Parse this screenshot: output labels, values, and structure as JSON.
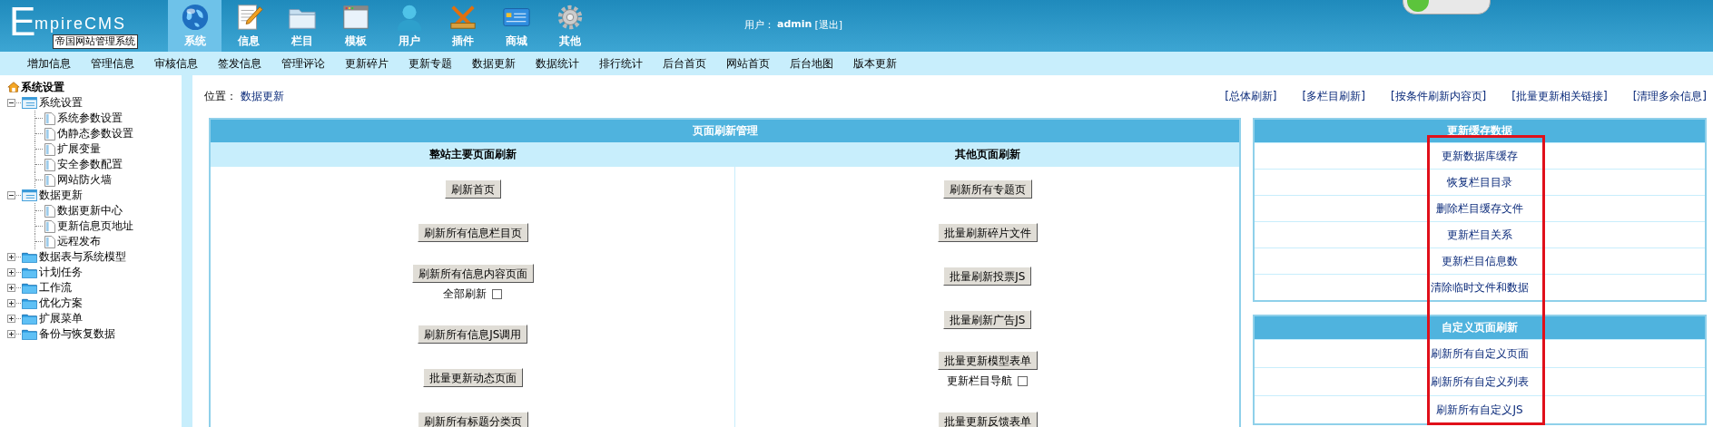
{
  "logo": {
    "big": "E",
    "rest": "mpireCMS",
    "caption": "帝国网站管理系统"
  },
  "nav": [
    {
      "label": "系统",
      "selected": true
    },
    {
      "label": "信息",
      "selected": false
    },
    {
      "label": "栏目",
      "selected": false
    },
    {
      "label": "模板",
      "selected": false
    },
    {
      "label": "用户",
      "selected": false
    },
    {
      "label": "插件",
      "selected": false
    },
    {
      "label": "商城",
      "selected": false
    },
    {
      "label": "其他",
      "selected": false
    }
  ],
  "user": {
    "label": "用户：",
    "name": "admin",
    "logout": "[退出]"
  },
  "menu": [
    "增加信息",
    "管理信息",
    "审核信息",
    "签发信息",
    "管理评论",
    "更新碎片",
    "更新专题",
    "数据更新",
    "数据统计",
    "排行统计",
    "后台首页",
    "网站首页",
    "后台地图",
    "版本更新"
  ],
  "sidebar": {
    "title": "系统设置",
    "items": [
      {
        "label": "系统设置",
        "expanded": true,
        "children": [
          {
            "label": "系统参数设置"
          },
          {
            "label": "伪静态参数设置"
          },
          {
            "label": "扩展变量"
          },
          {
            "label": "安全参数配置"
          },
          {
            "label": "网站防火墙"
          }
        ]
      },
      {
        "label": "数据更新",
        "expanded": true,
        "children": [
          {
            "label": "数据更新中心"
          },
          {
            "label": "更新信息页地址"
          },
          {
            "label": "远程发布"
          }
        ]
      },
      {
        "label": "数据表与系统模型",
        "expanded": false
      },
      {
        "label": "计划任务",
        "expanded": false
      },
      {
        "label": "工作流",
        "expanded": false
      },
      {
        "label": "优化方案",
        "expanded": false
      },
      {
        "label": "扩展菜单",
        "expanded": false
      },
      {
        "label": "备份与恢复数据",
        "expanded": false
      }
    ]
  },
  "location": {
    "label": "位置：",
    "link": "数据更新"
  },
  "top_links": [
    "[总体刷新]",
    "[多栏目刷新]",
    "[按条件刷新内容页]",
    "[批量更新相关链接]",
    "[清理多余信息]"
  ],
  "refresh_panel": {
    "title": "页面刷新管理",
    "columns": [
      {
        "heading": "整站主要页面刷新",
        "groups": [
          {
            "button": "刷新首页"
          },
          {
            "button": "刷新所有信息栏目页"
          },
          {
            "button": "刷新所有信息内容页面",
            "checkbox": {
              "label": "全部刷新",
              "checked": false
            }
          },
          {
            "button": "刷新所有信息JS调用"
          },
          {
            "button": "批量更新动态页面"
          },
          {
            "button": "刷新所有标题分类页"
          }
        ]
      },
      {
        "heading": "其他页面刷新",
        "groups": [
          {
            "button": "刷新所有专题页"
          },
          {
            "button": "批量刷新碎片文件"
          },
          {
            "button": "批量刷新投票JS"
          },
          {
            "button": "批量刷新广告JS"
          },
          {
            "button": "批量更新模型表单",
            "checkbox": {
              "label": "更新栏目导航",
              "checked": false
            }
          },
          {
            "button": "批量更新反馈表单"
          }
        ]
      }
    ]
  },
  "side_panels": [
    {
      "title": "更新缓存数据",
      "links": [
        "更新数据库缓存",
        "恢复栏目目录",
        "删除栏目缓存文件",
        "更新栏目关系",
        "更新栏目信息数",
        "清除临时文件和数据"
      ]
    },
    {
      "title": "自定义页面刷新",
      "links": [
        "刷新所有自定义页面",
        "刷新所有自定义列表",
        "刷新所有自定义JS"
      ]
    }
  ],
  "highlight": true
}
